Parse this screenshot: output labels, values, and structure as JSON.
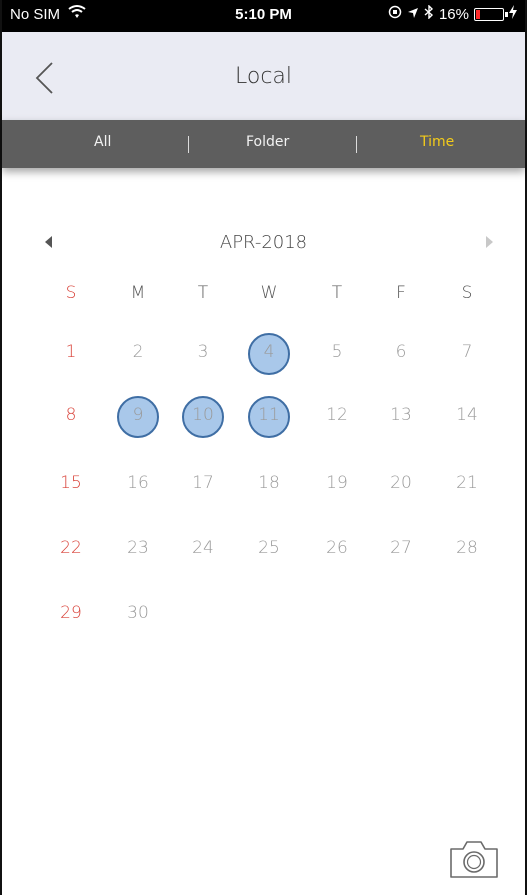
{
  "status_bar": {
    "carrier": "No SIM",
    "time": "5:10 PM",
    "battery": "16%",
    "battery_level": 0.16
  },
  "nav": {
    "title": "Local"
  },
  "tabs": [
    {
      "label": "All",
      "active": false
    },
    {
      "label": "Folder",
      "active": false
    },
    {
      "label": "Time",
      "active": true
    }
  ],
  "calendar": {
    "month_label": "APR-2018",
    "weekdays": [
      "S",
      "M",
      "T",
      "W",
      "T",
      "F",
      "S"
    ],
    "weeks": [
      [
        "1",
        "2",
        "3",
        "4",
        "5",
        "6",
        "7"
      ],
      [
        "8",
        "9",
        "10",
        "11",
        "12",
        "13",
        "14"
      ],
      [
        "15",
        "16",
        "17",
        "18",
        "19",
        "20",
        "21"
      ],
      [
        "22",
        "23",
        "24",
        "25",
        "26",
        "27",
        "28"
      ],
      [
        "29",
        "30",
        "",
        "",
        "",
        "",
        ""
      ]
    ],
    "highlighted_days": [
      "4",
      "9",
      "10",
      "11"
    ]
  },
  "colors": {
    "tab_active": "#f3cb1a",
    "sunday": "#d9433a",
    "highlight_fill": "#a9c8ea",
    "highlight_border": "#3f6ea4"
  },
  "icons": {
    "back": "chevron-left-icon",
    "camera": "camera-icon",
    "prev": "triangle-left-icon",
    "next": "triangle-right-icon"
  }
}
